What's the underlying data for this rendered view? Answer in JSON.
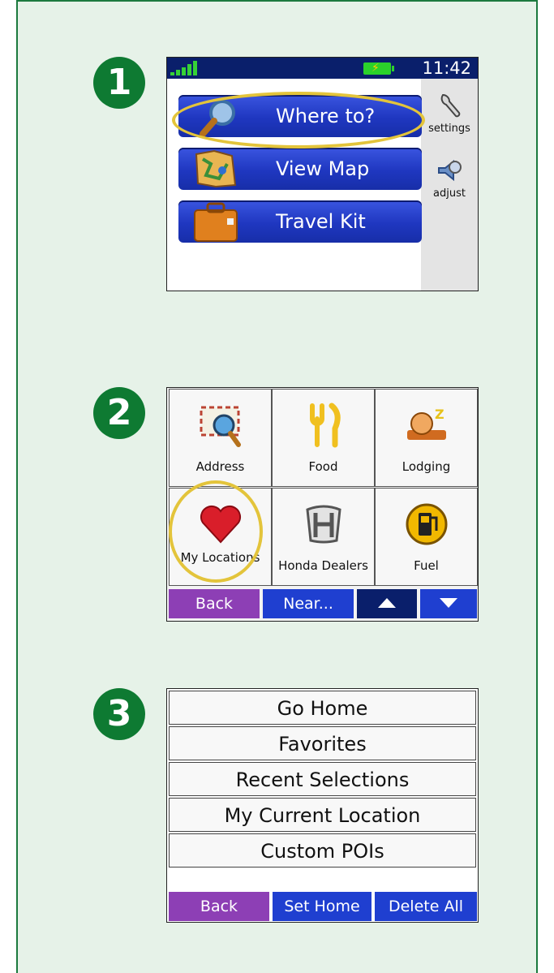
{
  "steps": [
    "1",
    "2",
    "3"
  ],
  "colors": {
    "accent_green": "#0e7a32",
    "highlight": "#e3c43b",
    "button_blue": "#1f37c0",
    "back_purple": "#8d3fb5"
  },
  "screen1": {
    "status_bar": {
      "clock": "11:42",
      "signal_icon": "signal-bars-icon",
      "battery_icon": "battery-icon"
    },
    "main_buttons": [
      {
        "label": "Where to?",
        "icon": "magnifier-icon"
      },
      {
        "label": "View Map",
        "icon": "map-icon"
      },
      {
        "label": "Travel Kit",
        "icon": "suitcase-icon"
      }
    ],
    "side_buttons": [
      {
        "label": "settings",
        "icon": "wrench-icon"
      },
      {
        "label": "adjust",
        "icon": "speaker-icon"
      }
    ]
  },
  "screen2": {
    "categories": [
      {
        "label": "Address",
        "icon": "address-envelope-icon"
      },
      {
        "label": "Food",
        "icon": "fork-knife-icon"
      },
      {
        "label": "Lodging",
        "icon": "sleeping-face-icon"
      },
      {
        "label": "My Locations",
        "icon": "heart-icon"
      },
      {
        "label": "Honda Dealers",
        "icon": "honda-logo-icon"
      },
      {
        "label": "Fuel",
        "icon": "fuel-pump-icon"
      }
    ],
    "toolbar": {
      "back": "Back",
      "near": "Near...",
      "up_icon": "arrow-up-icon",
      "down_icon": "arrow-down-icon"
    }
  },
  "screen3": {
    "items": [
      "Go Home",
      "Favorites",
      "Recent Selections",
      "My Current Location",
      "Custom POIs"
    ],
    "toolbar": {
      "back": "Back",
      "set_home": "Set Home",
      "delete_all": "Delete All"
    }
  }
}
